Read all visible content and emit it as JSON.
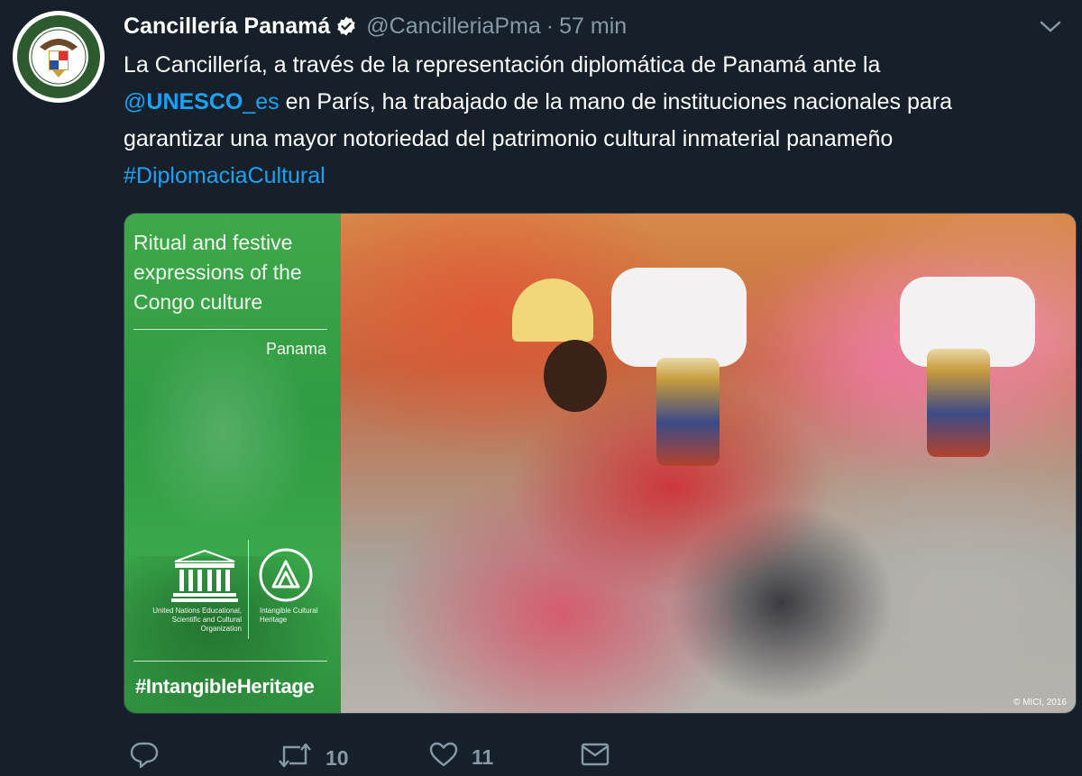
{
  "account": {
    "display_name": "Cancillería Panamá",
    "handle": "@CancilleriaPma",
    "separator": "·",
    "time_ago": "57 min",
    "verified": true,
    "avatar_seal_text": "MINISTERIO DE RELACIONES EXTERIORES",
    "avatar_seal_year": "1903"
  },
  "tweet": {
    "line1": "La Cancillería, a través de la representación diplomática de Panamá ante la",
    "mention_at": "@",
    "mention_name": "UNESCO",
    "mention_suffix": "_es",
    "line2_rest": " en París, ha trabajado de la mano de instituciones nacionales para",
    "line3": "garantizar una mayor notoriedad del patrimonio cultural inmaterial  panameño",
    "hashtag": "#DiplomaciaCultural"
  },
  "media": {
    "card_title": "Ritual and festive expressions of the Congo culture",
    "card_country": "Panama",
    "unesco_org_text": "United Nations Educational, Scientific and Cultural Organization",
    "ich_text": "Intangible Cultural Heritage",
    "card_hashtag": "#IntangibleHeritage",
    "photo_credit": "© MICI, 2016"
  },
  "actions": {
    "reply_count": "",
    "retweet_count": "10",
    "like_count": "11",
    "icons": [
      "reply-icon",
      "retweet-icon",
      "like-icon",
      "message-icon"
    ]
  },
  "colors": {
    "background": "#15202b",
    "link": "#1da1f2",
    "muted": "#8899a6",
    "card_green": "#3aa84a"
  }
}
